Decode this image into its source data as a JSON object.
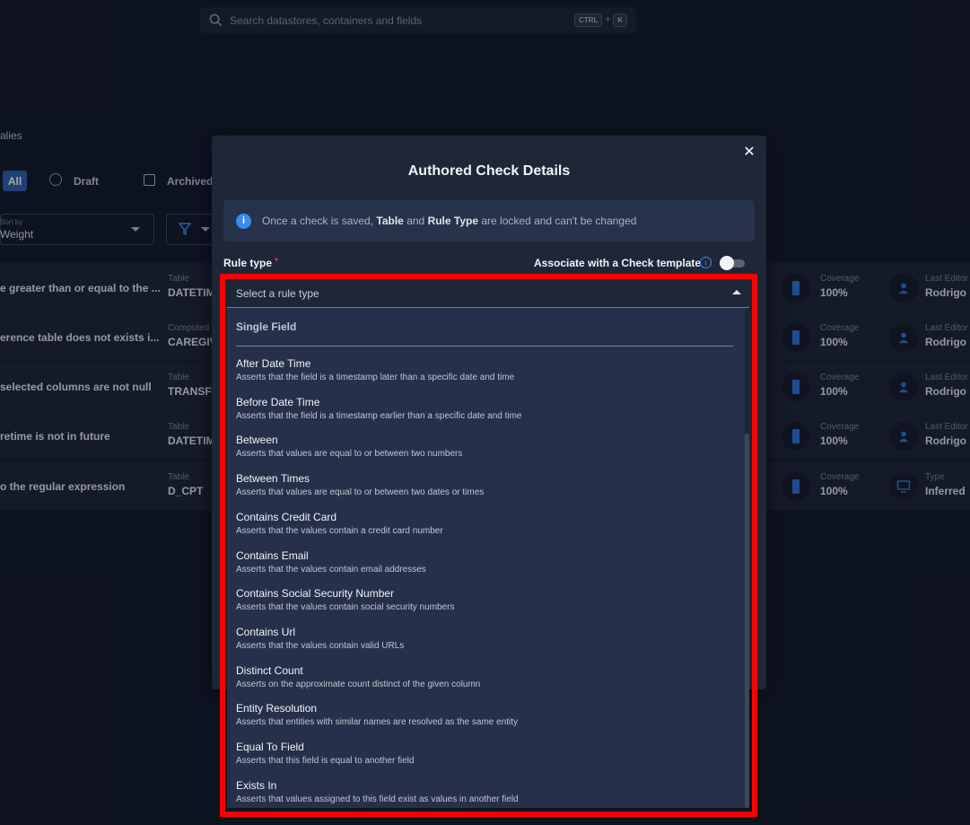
{
  "search": {
    "placeholder": "Search datastores, containers and fields",
    "shortcut_key1": "CTRL",
    "shortcut_plus": "+",
    "shortcut_key2": "K"
  },
  "page": {
    "breadcrumb_fragment": "alies",
    "tabs": {
      "all": "All",
      "draft": "Draft",
      "archived": "Archived"
    },
    "sort": {
      "label": "Sort by",
      "value": "Weight"
    },
    "rows": [
      {
        "title": "e greater than or equal to the ...",
        "type_label": "Table",
        "type_value": "DATETIM",
        "coverage_label": "Coverage",
        "coverage_value": "100%",
        "meta_label": "Last Editor",
        "meta_value": "Rodrigo",
        "meta_icon": "user-icon"
      },
      {
        "title": "erence table does not exists i...",
        "type_label": "Computed",
        "type_value": "CAREGIV",
        "coverage_label": "Coverage",
        "coverage_value": "100%",
        "meta_label": "Last Editor",
        "meta_value": "Rodrigo",
        "meta_icon": "user-icon"
      },
      {
        "title": "selected columns are not null",
        "type_label": "Table",
        "type_value": "TRANSFE",
        "coverage_label": "Coverage",
        "coverage_value": "100%",
        "meta_label": "Last Editor",
        "meta_value": "Rodrigo",
        "meta_icon": "user-icon"
      },
      {
        "title": "retime is not in future",
        "type_label": "Table",
        "type_value": "DATETIM",
        "coverage_label": "Coverage",
        "coverage_value": "100%",
        "meta_label": "Last Editor",
        "meta_value": "Rodrigo",
        "meta_icon": "user-icon"
      },
      {
        "title": "o the regular expression",
        "type_label": "Table",
        "type_value": "D_CPT",
        "coverage_label": "Coverage",
        "coverage_value": "100%",
        "meta_label": "Type",
        "meta_value": "Inferred",
        "meta_icon": "monitor-icon"
      }
    ]
  },
  "modal": {
    "title": "Authored Check Details",
    "info": {
      "prefix": "Once a check is saved, ",
      "bold1": "Table",
      "mid": " and ",
      "bold2": "Rule Type",
      "suffix": " are locked and can't be changed"
    },
    "rule_type_label": "Rule type",
    "required_mark": "*",
    "associate_label": "Associate with a Check template",
    "associate_enabled": false
  },
  "dropdown": {
    "placeholder": "Select a rule type",
    "group": "Single Field",
    "options": [
      {
        "label": "After Date Time",
        "desc": "Asserts that the field is a timestamp later than a specific date and time"
      },
      {
        "label": "Before Date Time",
        "desc": "Asserts that the field is a timestamp earlier than a specific date and time"
      },
      {
        "label": "Between",
        "desc": "Asserts that values are equal to or between two numbers"
      },
      {
        "label": "Between Times",
        "desc": "Asserts that values are equal to or between two dates or times"
      },
      {
        "label": "Contains Credit Card",
        "desc": "Asserts that the values contain a credit card number"
      },
      {
        "label": "Contains Email",
        "desc": "Asserts that the values contain email addresses"
      },
      {
        "label": "Contains Social Security Number",
        "desc": "Asserts that the values contain social security numbers"
      },
      {
        "label": "Contains Url",
        "desc": "Asserts that the values contain valid URLs"
      },
      {
        "label": "Distinct Count",
        "desc": "Asserts on the approximate count distinct of the given column"
      },
      {
        "label": "Entity Resolution",
        "desc": "Asserts that entities with similar names are resolved as the same entity"
      },
      {
        "label": "Equal To Field",
        "desc": "Asserts that this field is equal to another field"
      },
      {
        "label": "Exists In",
        "desc": "Asserts that values assigned to this field exist as values in another field"
      }
    ]
  },
  "colors": {
    "background": "#121827",
    "modal": "#1e2638",
    "menu": "#26304a",
    "accent": "#3b8cf0",
    "highlight": "#ff0000",
    "required": "#e3415c"
  }
}
